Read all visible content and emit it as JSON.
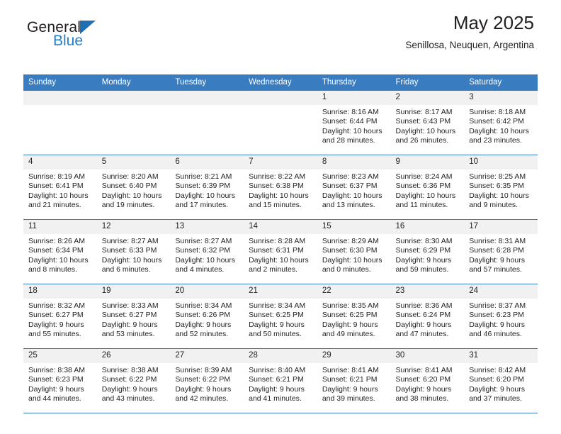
{
  "brand": {
    "name_top": "General",
    "name_bottom": "Blue",
    "triangle_color": "#1f6fb5",
    "blue_color": "#1f7fd0"
  },
  "header": {
    "title": "May 2025",
    "subtitle": "Senillosa, Neuquen, Argentina",
    "header_bg": "#3a7cc0",
    "daynum_bg": "#f1f1f1"
  },
  "weekday_headers": [
    "Sunday",
    "Monday",
    "Tuesday",
    "Wednesday",
    "Thursday",
    "Friday",
    "Saturday"
  ],
  "labels": {
    "sunrise": "Sunrise:",
    "sunset": "Sunset:",
    "daylight": "Daylight:"
  },
  "weeks": [
    [
      {
        "day": "",
        "empty": true
      },
      {
        "day": "",
        "empty": true
      },
      {
        "day": "",
        "empty": true
      },
      {
        "day": "",
        "empty": true
      },
      {
        "day": "1",
        "sunrise": "Sunrise: 8:16 AM",
        "sunset": "Sunset: 6:44 PM",
        "daylight_line1": "Daylight: 10 hours",
        "daylight_line2": "and 28 minutes."
      },
      {
        "day": "2",
        "sunrise": "Sunrise: 8:17 AM",
        "sunset": "Sunset: 6:43 PM",
        "daylight_line1": "Daylight: 10 hours",
        "daylight_line2": "and 26 minutes."
      },
      {
        "day": "3",
        "sunrise": "Sunrise: 8:18 AM",
        "sunset": "Sunset: 6:42 PM",
        "daylight_line1": "Daylight: 10 hours",
        "daylight_line2": "and 23 minutes."
      }
    ],
    [
      {
        "day": "4",
        "sunrise": "Sunrise: 8:19 AM",
        "sunset": "Sunset: 6:41 PM",
        "daylight_line1": "Daylight: 10 hours",
        "daylight_line2": "and 21 minutes."
      },
      {
        "day": "5",
        "sunrise": "Sunrise: 8:20 AM",
        "sunset": "Sunset: 6:40 PM",
        "daylight_line1": "Daylight: 10 hours",
        "daylight_line2": "and 19 minutes."
      },
      {
        "day": "6",
        "sunrise": "Sunrise: 8:21 AM",
        "sunset": "Sunset: 6:39 PM",
        "daylight_line1": "Daylight: 10 hours",
        "daylight_line2": "and 17 minutes."
      },
      {
        "day": "7",
        "sunrise": "Sunrise: 8:22 AM",
        "sunset": "Sunset: 6:38 PM",
        "daylight_line1": "Daylight: 10 hours",
        "daylight_line2": "and 15 minutes."
      },
      {
        "day": "8",
        "sunrise": "Sunrise: 8:23 AM",
        "sunset": "Sunset: 6:37 PM",
        "daylight_line1": "Daylight: 10 hours",
        "daylight_line2": "and 13 minutes."
      },
      {
        "day": "9",
        "sunrise": "Sunrise: 8:24 AM",
        "sunset": "Sunset: 6:36 PM",
        "daylight_line1": "Daylight: 10 hours",
        "daylight_line2": "and 11 minutes."
      },
      {
        "day": "10",
        "sunrise": "Sunrise: 8:25 AM",
        "sunset": "Sunset: 6:35 PM",
        "daylight_line1": "Daylight: 10 hours",
        "daylight_line2": "and 9 minutes."
      }
    ],
    [
      {
        "day": "11",
        "sunrise": "Sunrise: 8:26 AM",
        "sunset": "Sunset: 6:34 PM",
        "daylight_line1": "Daylight: 10 hours",
        "daylight_line2": "and 8 minutes."
      },
      {
        "day": "12",
        "sunrise": "Sunrise: 8:27 AM",
        "sunset": "Sunset: 6:33 PM",
        "daylight_line1": "Daylight: 10 hours",
        "daylight_line2": "and 6 minutes."
      },
      {
        "day": "13",
        "sunrise": "Sunrise: 8:27 AM",
        "sunset": "Sunset: 6:32 PM",
        "daylight_line1": "Daylight: 10 hours",
        "daylight_line2": "and 4 minutes."
      },
      {
        "day": "14",
        "sunrise": "Sunrise: 8:28 AM",
        "sunset": "Sunset: 6:31 PM",
        "daylight_line1": "Daylight: 10 hours",
        "daylight_line2": "and 2 minutes."
      },
      {
        "day": "15",
        "sunrise": "Sunrise: 8:29 AM",
        "sunset": "Sunset: 6:30 PM",
        "daylight_line1": "Daylight: 10 hours",
        "daylight_line2": "and 0 minutes."
      },
      {
        "day": "16",
        "sunrise": "Sunrise: 8:30 AM",
        "sunset": "Sunset: 6:29 PM",
        "daylight_line1": "Daylight: 9 hours",
        "daylight_line2": "and 59 minutes."
      },
      {
        "day": "17",
        "sunrise": "Sunrise: 8:31 AM",
        "sunset": "Sunset: 6:28 PM",
        "daylight_line1": "Daylight: 9 hours",
        "daylight_line2": "and 57 minutes."
      }
    ],
    [
      {
        "day": "18",
        "sunrise": "Sunrise: 8:32 AM",
        "sunset": "Sunset: 6:27 PM",
        "daylight_line1": "Daylight: 9 hours",
        "daylight_line2": "and 55 minutes."
      },
      {
        "day": "19",
        "sunrise": "Sunrise: 8:33 AM",
        "sunset": "Sunset: 6:27 PM",
        "daylight_line1": "Daylight: 9 hours",
        "daylight_line2": "and 53 minutes."
      },
      {
        "day": "20",
        "sunrise": "Sunrise: 8:34 AM",
        "sunset": "Sunset: 6:26 PM",
        "daylight_line1": "Daylight: 9 hours",
        "daylight_line2": "and 52 minutes."
      },
      {
        "day": "21",
        "sunrise": "Sunrise: 8:34 AM",
        "sunset": "Sunset: 6:25 PM",
        "daylight_line1": "Daylight: 9 hours",
        "daylight_line2": "and 50 minutes."
      },
      {
        "day": "22",
        "sunrise": "Sunrise: 8:35 AM",
        "sunset": "Sunset: 6:25 PM",
        "daylight_line1": "Daylight: 9 hours",
        "daylight_line2": "and 49 minutes."
      },
      {
        "day": "23",
        "sunrise": "Sunrise: 8:36 AM",
        "sunset": "Sunset: 6:24 PM",
        "daylight_line1": "Daylight: 9 hours",
        "daylight_line2": "and 47 minutes."
      },
      {
        "day": "24",
        "sunrise": "Sunrise: 8:37 AM",
        "sunset": "Sunset: 6:23 PM",
        "daylight_line1": "Daylight: 9 hours",
        "daylight_line2": "and 46 minutes."
      }
    ],
    [
      {
        "day": "25",
        "sunrise": "Sunrise: 8:38 AM",
        "sunset": "Sunset: 6:23 PM",
        "daylight_line1": "Daylight: 9 hours",
        "daylight_line2": "and 44 minutes."
      },
      {
        "day": "26",
        "sunrise": "Sunrise: 8:38 AM",
        "sunset": "Sunset: 6:22 PM",
        "daylight_line1": "Daylight: 9 hours",
        "daylight_line2": "and 43 minutes."
      },
      {
        "day": "27",
        "sunrise": "Sunrise: 8:39 AM",
        "sunset": "Sunset: 6:22 PM",
        "daylight_line1": "Daylight: 9 hours",
        "daylight_line2": "and 42 minutes."
      },
      {
        "day": "28",
        "sunrise": "Sunrise: 8:40 AM",
        "sunset": "Sunset: 6:21 PM",
        "daylight_line1": "Daylight: 9 hours",
        "daylight_line2": "and 41 minutes."
      },
      {
        "day": "29",
        "sunrise": "Sunrise: 8:41 AM",
        "sunset": "Sunset: 6:21 PM",
        "daylight_line1": "Daylight: 9 hours",
        "daylight_line2": "and 39 minutes."
      },
      {
        "day": "30",
        "sunrise": "Sunrise: 8:41 AM",
        "sunset": "Sunset: 6:20 PM",
        "daylight_line1": "Daylight: 9 hours",
        "daylight_line2": "and 38 minutes."
      },
      {
        "day": "31",
        "sunrise": "Sunrise: 8:42 AM",
        "sunset": "Sunset: 6:20 PM",
        "daylight_line1": "Daylight: 9 hours",
        "daylight_line2": "and 37 minutes."
      }
    ]
  ]
}
